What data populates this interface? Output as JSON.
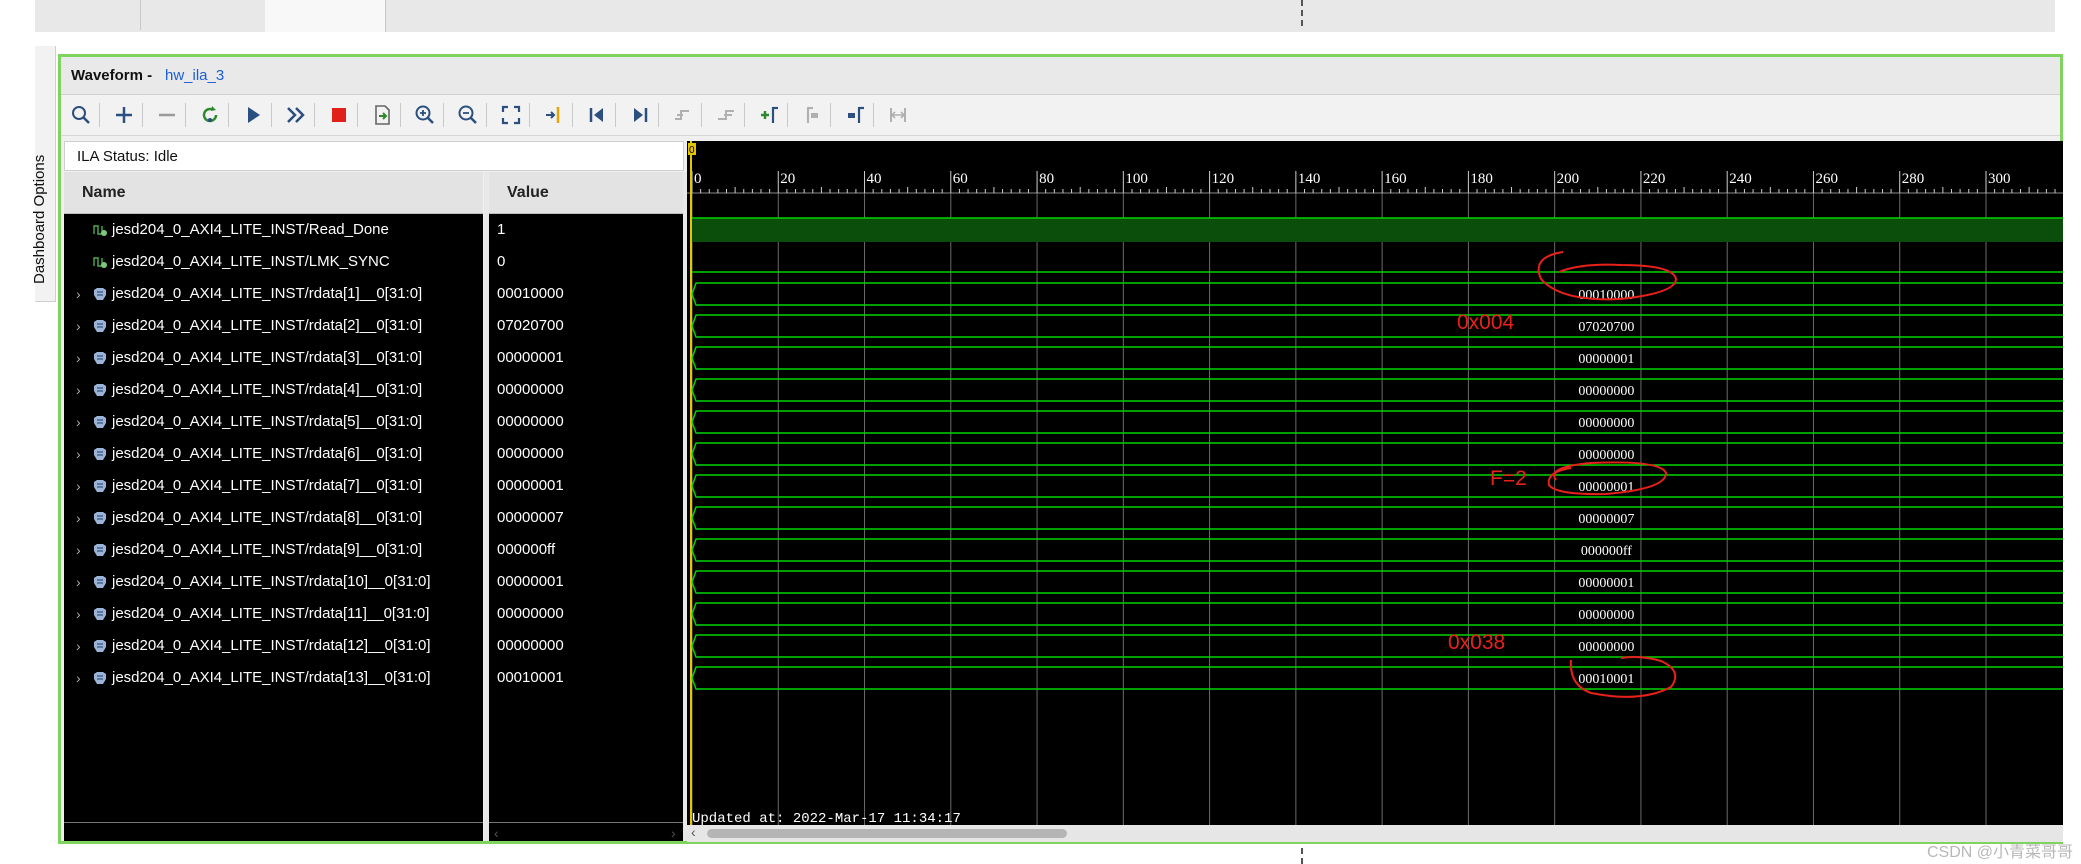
{
  "panel": {
    "title": "Waveform -",
    "subtitle": "hw_ila_3"
  },
  "sidebar": {
    "label": "Dashboard Options"
  },
  "toolbar": {
    "buttons": [
      "search-icon",
      "zoom-add-icon",
      "remove-icon",
      "refresh-icon",
      "run-trigger-icon",
      "run-immediate-icon",
      "stop-icon",
      "export-icon",
      "zoom-in-icon",
      "zoom-out-icon",
      "zoom-fit-icon",
      "goto-cursor-icon",
      "goto-start-icon",
      "goto-end-icon",
      "prev-transition-icon",
      "next-transition-icon",
      "add-marker-icon",
      "prev-marker-icon",
      "next-marker-icon",
      "swap-cursors-icon"
    ]
  },
  "status": {
    "text": "ILA Status:  Idle"
  },
  "columns": {
    "name": "Name",
    "value": "Value"
  },
  "signals": [
    {
      "name": "jesd204_0_AXI4_LITE_INST/Read_Done",
      "value": "1",
      "type": "bit",
      "wave": ""
    },
    {
      "name": "jesd204_0_AXI4_LITE_INST/LMK_SYNC",
      "value": "0",
      "type": "bit",
      "wave": ""
    },
    {
      "name": "jesd204_0_AXI4_LITE_INST/rdata[1]__0[31:0]",
      "value": "00010000",
      "type": "bus",
      "wave": "00010000"
    },
    {
      "name": "jesd204_0_AXI4_LITE_INST/rdata[2]__0[31:0]",
      "value": "07020700",
      "type": "bus",
      "wave": "07020700"
    },
    {
      "name": "jesd204_0_AXI4_LITE_INST/rdata[3]__0[31:0]",
      "value": "00000001",
      "type": "bus",
      "wave": "00000001"
    },
    {
      "name": "jesd204_0_AXI4_LITE_INST/rdata[4]__0[31:0]",
      "value": "00000000",
      "type": "bus",
      "wave": "00000000"
    },
    {
      "name": "jesd204_0_AXI4_LITE_INST/rdata[5]__0[31:0]",
      "value": "00000000",
      "type": "bus",
      "wave": "00000000"
    },
    {
      "name": "jesd204_0_AXI4_LITE_INST/rdata[6]__0[31:0]",
      "value": "00000000",
      "type": "bus",
      "wave": "00000000"
    },
    {
      "name": "jesd204_0_AXI4_LITE_INST/rdata[7]__0[31:0]",
      "value": "00000001",
      "type": "bus",
      "wave": "00000001"
    },
    {
      "name": "jesd204_0_AXI4_LITE_INST/rdata[8]__0[31:0]",
      "value": "00000007",
      "type": "bus",
      "wave": "00000007"
    },
    {
      "name": "jesd204_0_AXI4_LITE_INST/rdata[9]__0[31:0]",
      "value": "000000ff",
      "type": "bus",
      "wave": "000000ff"
    },
    {
      "name": "jesd204_0_AXI4_LITE_INST/rdata[10]__0[31:0]",
      "value": "00000001",
      "type": "bus",
      "wave": "00000001"
    },
    {
      "name": "jesd204_0_AXI4_LITE_INST/rdata[11]__0[31:0]",
      "value": "00000000",
      "type": "bus",
      "wave": "00000000"
    },
    {
      "name": "jesd204_0_AXI4_LITE_INST/rdata[12]__0[31:0]",
      "value": "00000000",
      "type": "bus",
      "wave": "00000000"
    },
    {
      "name": "jesd204_0_AXI4_LITE_INST/rdata[13]__0[31:0]",
      "value": "00010001",
      "type": "bus",
      "wave": "00010001"
    }
  ],
  "timeline": {
    "range": [
      0,
      316
    ],
    "ticks": [
      "0",
      "20",
      "40",
      "60",
      "80",
      "100",
      "120",
      "140",
      "160",
      "180",
      "200",
      "220",
      "240",
      "260",
      "280",
      "300"
    ],
    "cursor": "0"
  },
  "updated": "Updated at: 2022-Mar-17 11:34:17",
  "annotations": {
    "a1": "0x004",
    "a2": "F=2",
    "a3": "0x038"
  },
  "watermark": "CSDN @小青菜哥哥",
  "colors": {
    "frame": "#7fd35f",
    "wave": "#00d400",
    "wave_fill": "#0b4d0b",
    "annotation": "#e8221b"
  }
}
